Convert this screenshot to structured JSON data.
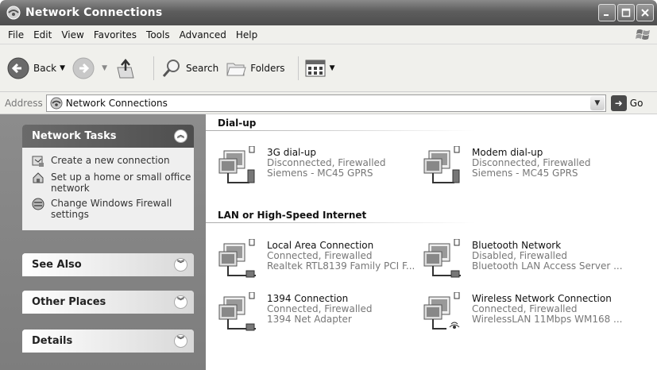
{
  "window": {
    "title": "Network Connections"
  },
  "menu": [
    "File",
    "Edit",
    "View",
    "Favorites",
    "Tools",
    "Advanced",
    "Help"
  ],
  "toolbar": {
    "back": "Back",
    "search": "Search",
    "folders": "Folders"
  },
  "address": {
    "label": "Address",
    "value": "Network Connections",
    "go": "Go"
  },
  "left": {
    "network_tasks": {
      "title": "Network Tasks",
      "links": [
        "Create a new connection",
        "Set up a home or small office network",
        "Change Windows Firewall settings"
      ]
    },
    "see_also": "See Also",
    "other_places": "Other Places",
    "details": "Details"
  },
  "groups": {
    "dialup": {
      "title": "Dial-up",
      "items": [
        {
          "name": "3G dial-up",
          "status": "Disconnected, Firewalled",
          "device": "Siemens - MC45 GPRS"
        },
        {
          "name": "Modem dial-up",
          "status": "Disconnected, Firewalled",
          "device": "Siemens - MC45 GPRS"
        }
      ]
    },
    "lan": {
      "title": "LAN or High-Speed Internet",
      "items": [
        {
          "name": "Local Area Connection",
          "status": "Connected, Firewalled",
          "device": "Realtek RTL8139 Family PCI F..."
        },
        {
          "name": "Bluetooth Network",
          "status": "Disabled, Firewalled",
          "device": "Bluetooth LAN Access Server ..."
        },
        {
          "name": "1394 Connection",
          "status": "Connected, Firewalled",
          "device": "1394 Net Adapter"
        },
        {
          "name": "Wireless Network Connection",
          "status": "Connected, Firewalled",
          "device": "WirelessLAN 11Mbps WM168 ..."
        }
      ]
    }
  }
}
